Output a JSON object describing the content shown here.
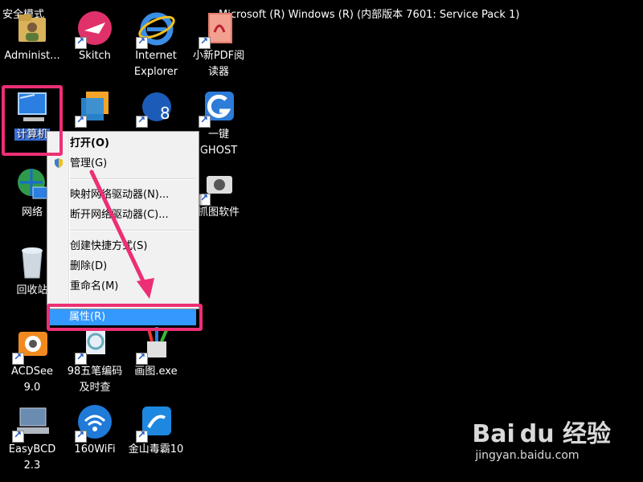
{
  "desktop": {
    "safe_mode_label": "安全模式",
    "build_text": "Microsoft (R) Windows (R) (内部版本 7601: Service Pack 1)",
    "icons": {
      "admin": "Administ...",
      "skitch": "Skitch",
      "ie_line1": "Internet",
      "ie_line2": "Explorer",
      "pdf_line1": "小新PDF阅",
      "pdf_line2": "读器",
      "computer": "计算机",
      "ghost_line1": "一键",
      "ghost_line2": "GHOST",
      "network": "网络",
      "capture": "抓图软件",
      "recycle": "回收站",
      "acdsee_line1": "ACDSee",
      "acdsee_line2": "9.0",
      "wubi_line1": "98五笔编码",
      "wubi_line2": "及时查",
      "paint": "画图.exe",
      "easybcd_line1": "EasyBCD",
      "easybcd_line2": "2.3",
      "wifi": "160WiFi",
      "kingsoft": "金山毒霸10"
    }
  },
  "context_menu": {
    "open": "打开(O)",
    "manage": "管理(G)",
    "map_drive": "映射网络驱动器(N)...",
    "disconnect_drive": "断开网络驱动器(C)...",
    "create_shortcut": "创建快捷方式(S)",
    "delete": "删除(D)",
    "rename": "重命名(M)",
    "properties": "属性(R)"
  },
  "watermark": {
    "brand": "Bai du 经验",
    "url": "jingyan.baidu.com"
  },
  "colors": {
    "annotation": "#ec2f74",
    "highlight": "#3399ff"
  }
}
